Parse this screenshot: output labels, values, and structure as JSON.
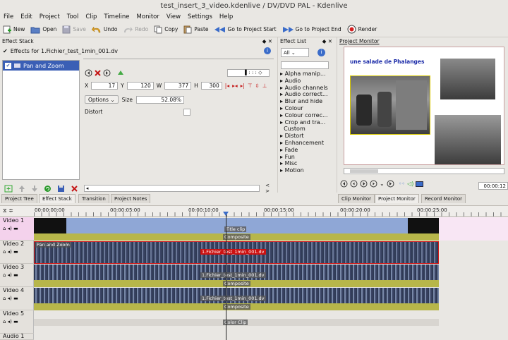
{
  "window": {
    "title": "test_insert_3_video.kdenlive / DV/DVD PAL - Kdenlive"
  },
  "menu": [
    "File",
    "Edit",
    "Project",
    "Tool",
    "Clip",
    "Timeline",
    "Monitor",
    "View",
    "Settings",
    "Help"
  ],
  "toolbar": {
    "new": "New",
    "open": "Open",
    "save": "Save",
    "undo": "Undo",
    "redo": "Redo",
    "copy": "Copy",
    "paste": "Paste",
    "goto_start": "Go to Project Start",
    "goto_end": "Go to Project End",
    "render": "Render"
  },
  "effect_stack": {
    "title": "Effect Stack",
    "effects_for": "Effects for 1.Fichier_test_1min_001.dv",
    "items": [
      "Pan and Zoom"
    ],
    "x_label": "X",
    "x": "17",
    "y_label": "Y",
    "y": "120",
    "w_label": "W",
    "w": "377",
    "h_label": "H",
    "h": "300",
    "options": "Options",
    "size_label": "Size",
    "size": "52.08%",
    "distort": "Distort"
  },
  "effect_list": {
    "title": "Effect List",
    "filter": "All",
    "items": [
      "Alpha manip...",
      "Audio",
      "Audio channels",
      "Audio correct...",
      "Blur and hide",
      "Colour",
      "Colour correc...",
      "Crop and tra...",
      "Custom",
      "Distort",
      "Enhancement",
      "Fade",
      "Fun",
      "Misc",
      "Motion"
    ]
  },
  "monitor": {
    "title": "Project Monitor",
    "overlay_text": "une salade de Phalanges",
    "timecode": "00:00:12"
  },
  "tabs_left": [
    "Project Tree",
    "Effect Stack",
    "Transition",
    "Project Notes"
  ],
  "tabs_right": [
    "Clip Monitor",
    "Project Monitor",
    "Record Monitor"
  ],
  "timeline": {
    "ticks": [
      "00:00:00:00",
      "00:00:05:00",
      "00:00:10:00",
      "00:00:15:00",
      "00:00:20:00",
      "00:00:25:00"
    ],
    "tracks": [
      "Video 1",
      "Video 2",
      "Video 3",
      "Video 4",
      "Video 5",
      "Audio 1"
    ],
    "clips": {
      "title": "Title clip",
      "composite": "Composite",
      "fichier": "1.Fichier_test_1min_001.dv",
      "pan_zoom": "Pan and Zoom",
      "color": "Color Clip"
    }
  },
  "colors": {
    "accent": "#3b5fb5",
    "clip_blue": "#8fa7d6",
    "clip_yellow": "#b7b64a",
    "selection": "#cc1111"
  }
}
